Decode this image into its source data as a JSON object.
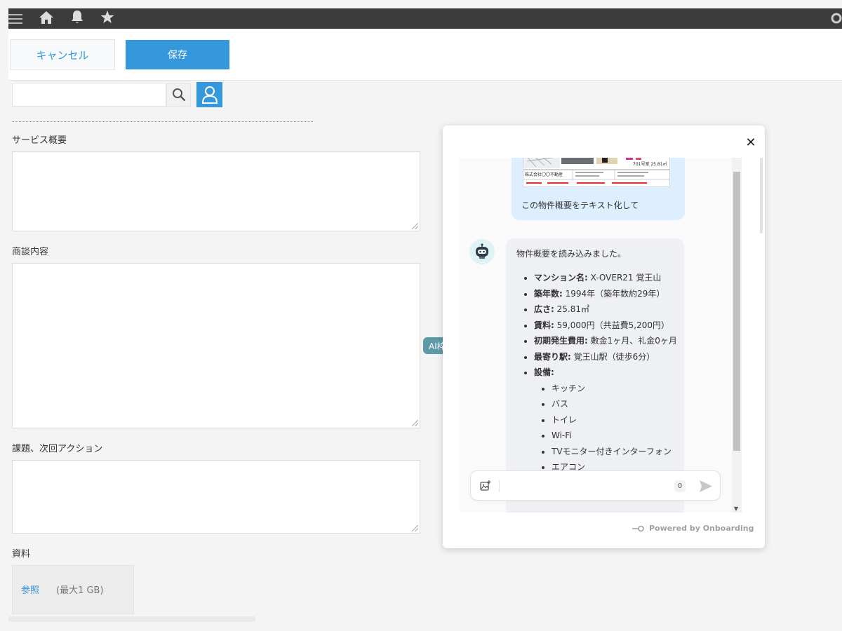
{
  "toolbar": {
    "cancel_label": "キャンセル",
    "save_label": "保存"
  },
  "search": {
    "value": ""
  },
  "fields": {
    "service_overview": "サービス概要",
    "negotiation": "商談内容",
    "issues": "課題、次回アクション",
    "materials": "資料"
  },
  "attachment": {
    "browse_label": "参照",
    "limit": "(最大1 GB)"
  },
  "ai_tag": "AI枠",
  "chat": {
    "user_message": "この物件概要をテキスト化して",
    "bot_intro": "物件概要を読み込みました。",
    "items": [
      {
        "label": "マンション名:",
        "value": " X-OVER21 覚王山"
      },
      {
        "label": "築年数:",
        "value": " 1994年（築年数約29年）"
      },
      {
        "label": "広さ:",
        "value": " 25.81㎡"
      },
      {
        "label": "賃料:",
        "value": " 59,000円（共益費5,200円）"
      },
      {
        "label": "初期発生費用:",
        "value": " 敷金1ヶ月、礼金0ヶ月"
      },
      {
        "label": "最寄り駅:",
        "value": " 覚王山駅（徒歩6分）"
      },
      {
        "label": "設備:",
        "value": ""
      }
    ],
    "facilities": [
      "キッチン",
      "バス",
      "トイレ",
      "Wi-Fi",
      "TVモニター付きインターフォン",
      "エアコン"
    ],
    "char_count": "0",
    "powered_by": "Powered by Onboarding"
  },
  "thumbnail": {
    "size_label": "701号室 25.81㎡",
    "company": "株式会社〇〇不動産"
  }
}
